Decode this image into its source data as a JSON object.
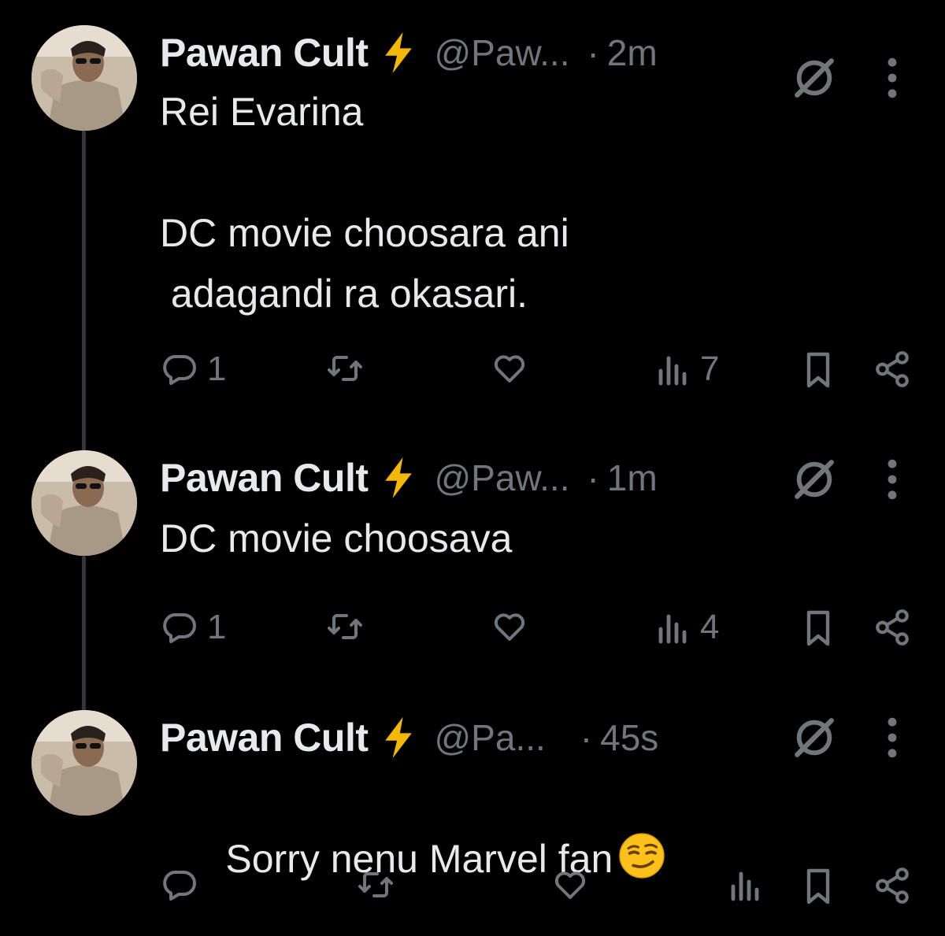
{
  "colors": {
    "background": "#000000",
    "text": "#e7e9ea",
    "muted": "#71767b",
    "bolt": "#f5b800"
  },
  "tweets": [
    {
      "name": "Pawan Cult",
      "handle": "@Paw...",
      "time": "2m",
      "text": "Rei Evarina\n\nDC movie choosara ani\n adagandi ra okasari.",
      "emoji": "",
      "replies": "1",
      "views": "7"
    },
    {
      "name": "Pawan Cult",
      "handle": "@Paw...",
      "time": "1m",
      "text": "DC movie choosava",
      "emoji": "",
      "replies": "1",
      "views": "4"
    },
    {
      "name": "Pawan Cult",
      "handle": "@Pa...",
      "time": "45s",
      "text": "Sorry nenu Marvel fan",
      "emoji": "smirking-face",
      "replies": "",
      "views": ""
    }
  ],
  "dot_separator": "·",
  "icons": [
    "lightning-bolt-icon",
    "grok-icon",
    "more-vertical-icon",
    "reply-icon",
    "repost-icon",
    "like-icon",
    "views-icon",
    "bookmark-icon",
    "share-icon"
  ]
}
